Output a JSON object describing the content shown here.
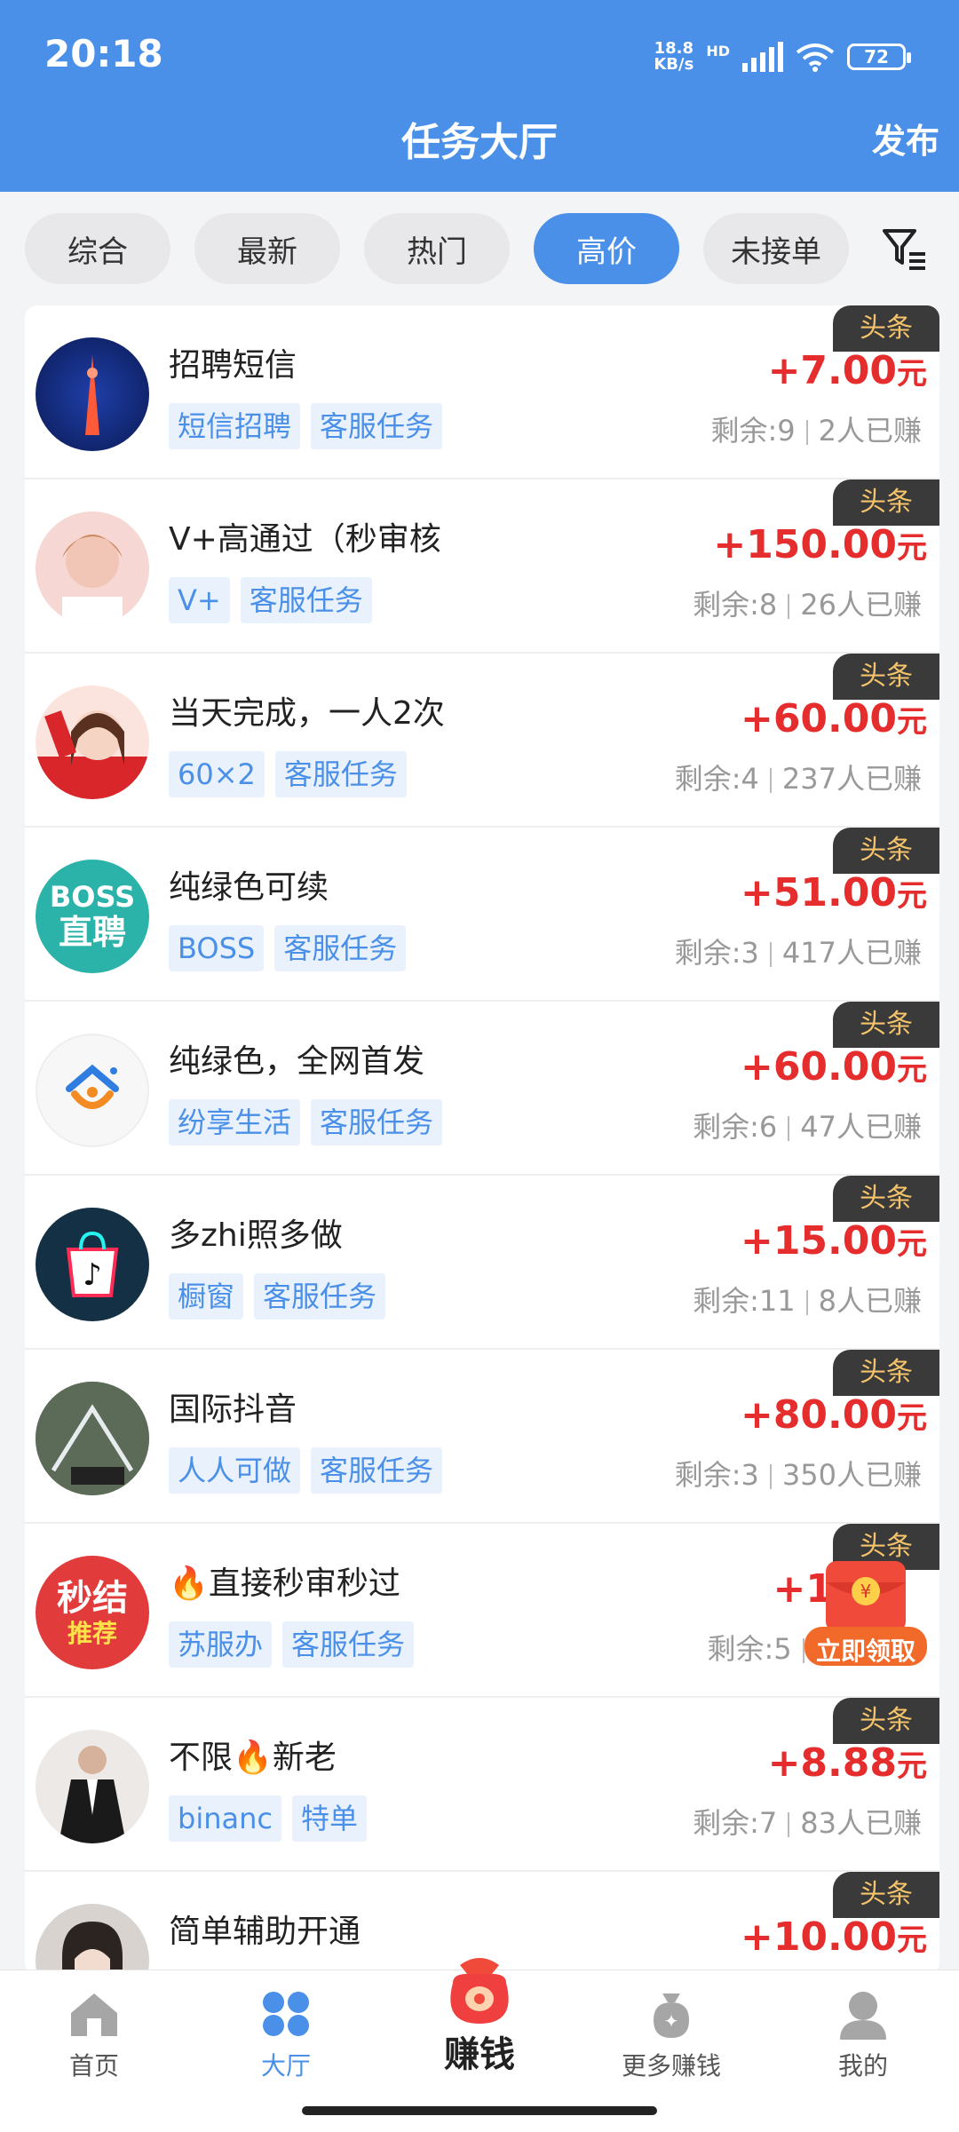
{
  "status": {
    "time": "20:18",
    "network_speed_top": "18.8",
    "network_speed_bottom": "KB/s",
    "hd": "HD",
    "battery": "72"
  },
  "header": {
    "title": "任务大厅",
    "publish_label": "发布"
  },
  "tabs": [
    {
      "label": "综合",
      "active": false
    },
    {
      "label": "最新",
      "active": false
    },
    {
      "label": "热门",
      "active": false
    },
    {
      "label": "高价",
      "active": true
    },
    {
      "label": "未接单",
      "active": false
    }
  ],
  "list": [
    {
      "title": "招聘短信",
      "tags": [
        "短信招聘",
        "客服任务"
      ],
      "badge": "头条",
      "price": "+7.00",
      "unit": "元",
      "remaining": "剩余:9",
      "earned": "2人已赚"
    },
    {
      "title": "V+高通过（秒审核",
      "tags": [
        "V+",
        "客服任务"
      ],
      "badge": "头条",
      "price": "+150.00",
      "unit": "元",
      "remaining": "剩余:8",
      "earned": "26人已赚"
    },
    {
      "title": "当天完成，一人2次",
      "tags": [
        "60×2",
        "客服任务"
      ],
      "badge": "头条",
      "price": "+60.00",
      "unit": "元",
      "remaining": "剩余:4",
      "earned": "237人已赚"
    },
    {
      "title": "纯绿色可续",
      "tags": [
        "BOSS",
        "客服任务"
      ],
      "badge": "头条",
      "price": "+51.00",
      "unit": "元",
      "remaining": "剩余:3",
      "earned": "417人已赚",
      "avatar_text": [
        "BOSS",
        "直聘"
      ]
    },
    {
      "title": "纯绿色，全网首发",
      "tags": [
        "纷享生活",
        "客服任务"
      ],
      "badge": "头条",
      "price": "+60.00",
      "unit": "元",
      "remaining": "剩余:6",
      "earned": "47人已赚"
    },
    {
      "title": "多zhi照多做",
      "tags": [
        "橱窗",
        "客服任务"
      ],
      "badge": "头条",
      "price": "+15.00",
      "unit": "元",
      "remaining": "剩余:11",
      "earned": "8人已赚"
    },
    {
      "title": "国际抖音",
      "tags": [
        "人人可做",
        "客服任务"
      ],
      "badge": "头条",
      "price": "+80.00",
      "unit": "元",
      "remaining": "剩余:3",
      "earned": "350人已赚"
    },
    {
      "title": "🔥直接秒审秒过",
      "tags": [
        "苏服办",
        "客服任务"
      ],
      "badge": "头条",
      "price": "+1",
      "unit": "",
      "remaining": "剩余:5",
      "earned": "1",
      "avatar_text": [
        "秒结",
        "推荐"
      ]
    },
    {
      "title": "不限🔥新老",
      "tags": [
        "binanc",
        "特单"
      ],
      "badge": "头条",
      "price": "+8.88",
      "unit": "元",
      "remaining": "剩余:7",
      "earned": "83人已赚"
    },
    {
      "title": "简单辅助开通",
      "tags": [],
      "badge": "头条",
      "price": "+10.00",
      "unit": "元",
      "remaining": "",
      "earned": ""
    }
  ],
  "red_packet": {
    "label": "立即领取"
  },
  "bottom_nav": [
    {
      "label": "首页",
      "icon": "home-icon",
      "active": false
    },
    {
      "label": "大厅",
      "icon": "grid-icon",
      "active": true
    },
    {
      "label": "赚钱",
      "icon": "money-bag-icon",
      "active": false
    },
    {
      "label": "更多赚钱",
      "icon": "coin-bag-icon",
      "active": false
    },
    {
      "label": "我的",
      "icon": "user-icon",
      "active": false
    }
  ],
  "colors": {
    "primary": "#4a90e8",
    "price_red": "#e52d2d",
    "badge_bg": "#3a3a3a",
    "badge_text": "#f5c36a"
  }
}
